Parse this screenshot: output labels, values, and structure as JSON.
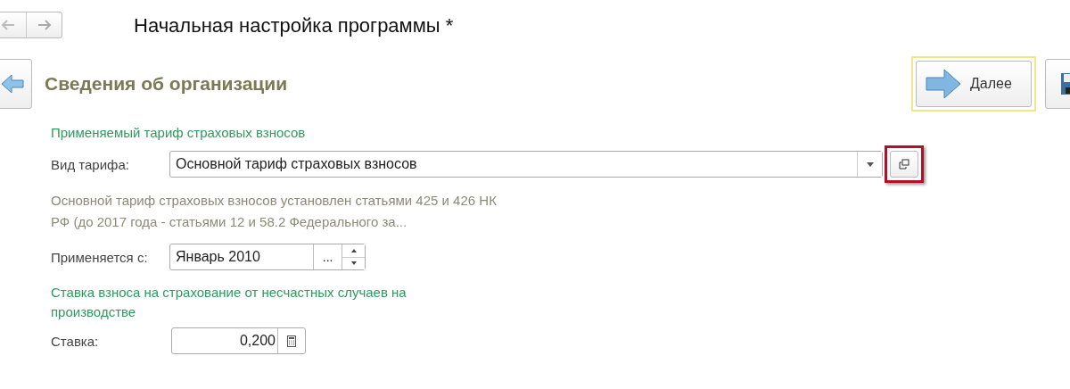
{
  "window": {
    "title": "Начальная настройка программы *"
  },
  "page": {
    "heading": "Сведения об организации",
    "next_button": "Далее"
  },
  "tariff_section": {
    "title": "Применяемый тариф страховых взносов",
    "label": "Вид тарифа:",
    "value": "Основной тариф страховых взносов",
    "highlighted": true,
    "description": "Основной тариф страховых взносов установлен статьями 425 и 426 НК РФ (до 2017 года - статьями 12 и 58.2 Федерального за...",
    "from_label": "Применяется с:",
    "from_value": "Январь 2010",
    "select_button": "..."
  },
  "accident_section": {
    "title": "Ставка взноса на страхование от несчастных случаев на производстве",
    "label": "Ставка:",
    "value": "0,200"
  }
}
